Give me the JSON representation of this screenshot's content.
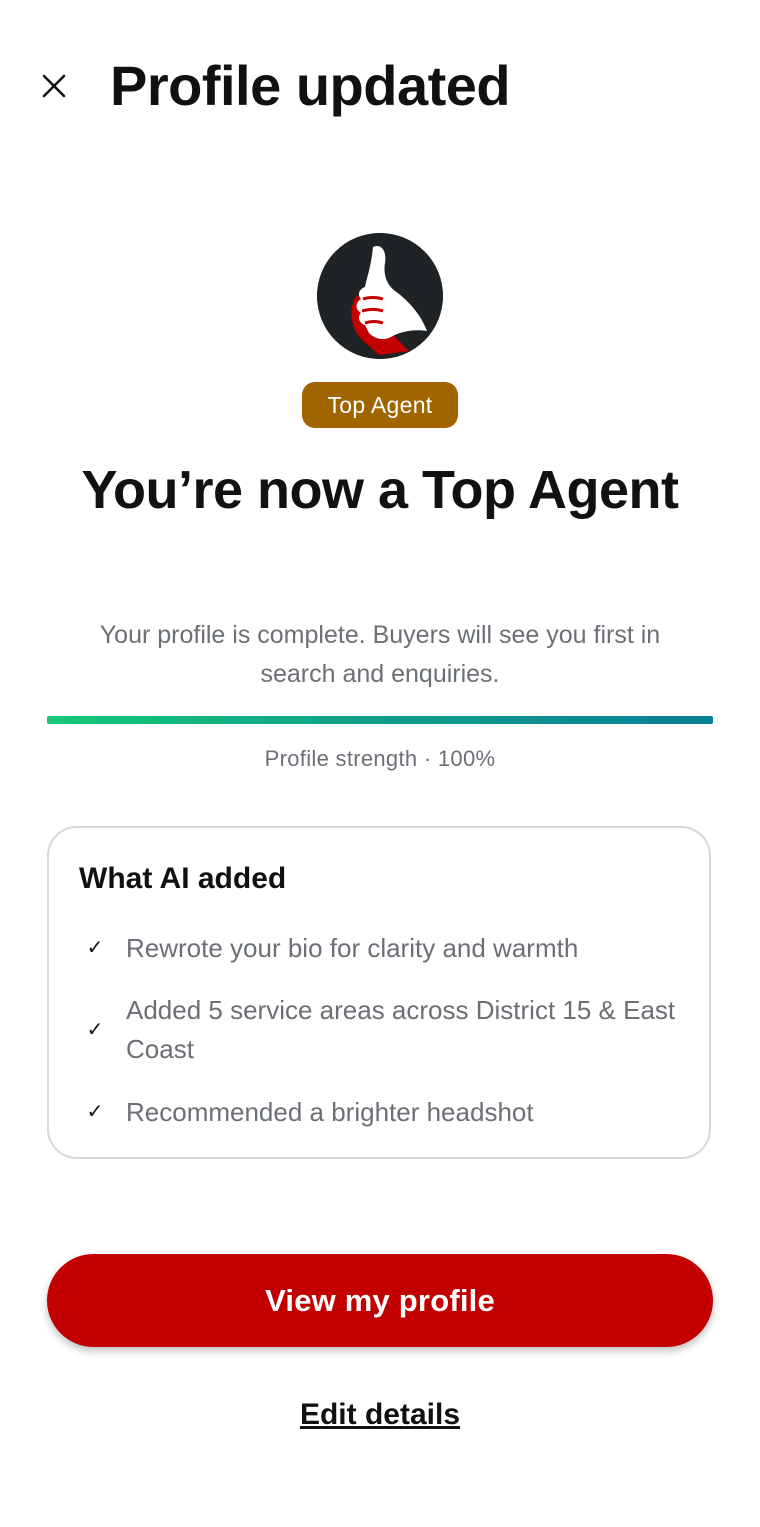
{
  "header": {
    "close_icon": "close-icon",
    "title": "Profile updated"
  },
  "hero": {
    "icon": "thumbs-up-icon",
    "icon_bg_color": "#202326",
    "icon_accent_color": "#c30000",
    "badge_label": "Top Agent",
    "badge_color": "#a16500",
    "headline": "You’re now a Top Agent",
    "subtext": "Your profile is complete. Buyers will see you first in search and enquiries."
  },
  "progress": {
    "percent": 100,
    "label": "Profile strength · 100%",
    "gradient_colors": [
      "#16c876",
      "#0a7f98"
    ]
  },
  "ai_card": {
    "title": "What AI added",
    "check_icon": "checkmark-icon",
    "items": [
      {
        "check": "✓",
        "text": "Rewrote your bio for clarity and warmth"
      },
      {
        "check": "✓",
        "text": "Added 5 service areas across District 15 & East Coast"
      },
      {
        "check": "✓",
        "text": "Recommended a brighter headshot"
      }
    ]
  },
  "actions": {
    "primary_label": "View my profile",
    "primary_color": "#c30000",
    "secondary_label": "Edit details"
  }
}
